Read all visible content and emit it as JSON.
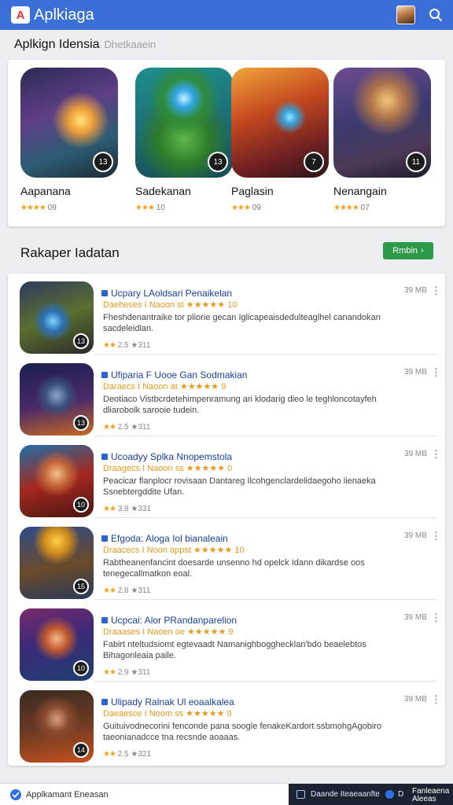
{
  "app": {
    "logo_glyph": "A",
    "title": "Aplkiaga",
    "accent": "#3a6fd8"
  },
  "featured": {
    "title": "Aplkign Idensia",
    "subtitle": "Dhetkaaein",
    "items": [
      {
        "name": "Aapanana",
        "rating": "09",
        "badge": "13",
        "stars": "★★★★"
      },
      {
        "name": "Sadekanan",
        "rating": "10",
        "badge": "13",
        "stars": "★★★"
      },
      {
        "name": "Paglasin",
        "rating": "09",
        "badge": "7",
        "stars": "★★★"
      },
      {
        "name": "Nenangain",
        "rating": "07",
        "badge": "11",
        "stars": "★★★★"
      }
    ]
  },
  "list": {
    "title": "Rakaper Iadatan",
    "action_label": "Rmbin",
    "items": [
      {
        "title": "Ucpary LAoldsari Penaikelan",
        "meta": "Daeheses I Naoon st ★★★★★ 10",
        "desc": "Fheshdenantraike tor pliorie gecan Iglicapeaisdedulteaglhel canandokan sacdeleidlan.",
        "stars": "★★",
        "rating": "2.5 ★311",
        "size": "39 MB",
        "badge": "13"
      },
      {
        "title": "Ufiparia F Uooe Gan Sodmakian",
        "meta": "Daraecs I Naoon at ★★★★★ 9",
        "desc": "Deotiaco Vistbcrdetehimpenramung ari klodarig dieo le teghloncotayfeh dliarobolk sarooie tudein.",
        "stars": "★★",
        "rating": "2.5 ★311",
        "size": "39 MB",
        "badge": "13"
      },
      {
        "title": "Ucoadyy Splka Nnopemstola",
        "meta": "Draagecs I Naoon ss ★★★★★ 0",
        "desc": "Peacicar flanplocr rovisaan Dantareg Ilcohgenclardelidaegoho lienaeka Ssnebtergddite Ufan.",
        "stars": "★★",
        "rating": "3.8 ★331",
        "size": "39 MB",
        "badge": "10"
      },
      {
        "title": "Efgoda: Aloga Iol bianaleain",
        "meta": "Draacecs I Noon appst ★★★★★ 10",
        "desc": "Rabtheanenfancint doesarde unsenno hd opelck Idann dikardse oos tenegecallmatkon eoal.",
        "stars": "★★",
        "rating": "2.8 ★311",
        "size": "39 MB",
        "badge": "15"
      },
      {
        "title": "Ucpcai: Alor PRandanparelion",
        "meta": "Draaases I Naoen oe ★★★★★ 9",
        "desc": "Fabirt nteltudsiomt egtevaadt Namanighbogghecklan'bdo beaelebtos Bihagonleaia paile.",
        "stars": "★★",
        "rating": "2.9 ★311",
        "size": "39 MB",
        "badge": "10"
      },
      {
        "title": "Ulipady Ralnak Ul eoaalkalea",
        "meta": "Daeaesce I Noom ss ★★★★★ 9",
        "desc": "Guituivodnecorini fenconde pana soogle fenakeKardort ssbmohgAgobiro taeonianadcce tna recsnde aoaaas.",
        "stars": "★★",
        "rating": "2.5 ★321",
        "size": "39 MB",
        "badge": "14"
      }
    ]
  },
  "bottom": {
    "label": "Applkamant Eneasan",
    "dark_label": "Daande Iteaeaanfte",
    "dark_num": "D",
    "dark_label2": "Fanleaena Aleeas"
  }
}
